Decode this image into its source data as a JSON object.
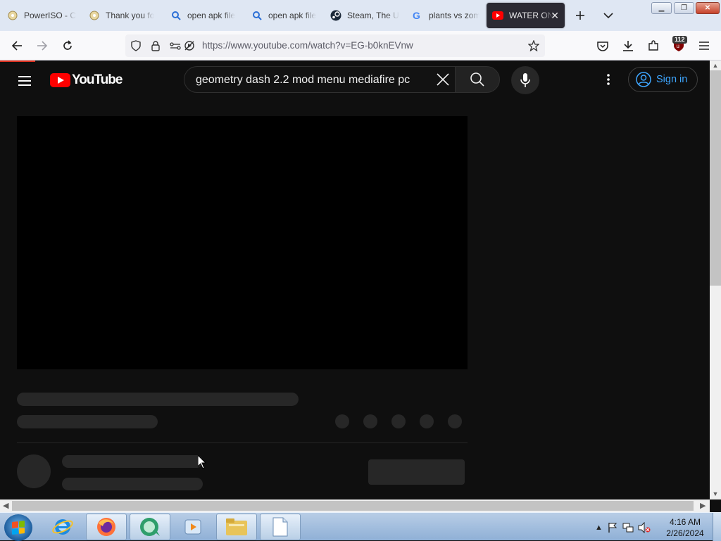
{
  "browser": {
    "tabs": [
      {
        "label": "PowerISO - C",
        "icon": "poweriso-icon"
      },
      {
        "label": "Thank you fo",
        "icon": "poweriso-icon"
      },
      {
        "label": "open apk file",
        "icon": "search-icon"
      },
      {
        "label": "open apk file",
        "icon": "search-icon"
      },
      {
        "label": "Steam, The U",
        "icon": "steam-icon"
      },
      {
        "label": "plants vs zom",
        "icon": "google-icon"
      },
      {
        "label": "WATER ON",
        "icon": "youtube-icon",
        "active": true
      }
    ],
    "url": "https://www.youtube.com/watch?v=EG-b0knEVnw",
    "extension_badge": "112"
  },
  "youtube": {
    "logo_text": "YouTube",
    "search_query": "geometry dash 2.2 mod menu mediafire pc",
    "sign_in_label": "Sign in"
  },
  "taskbar": {
    "time": "4:16 AM",
    "date": "2/26/2024"
  },
  "colors": {
    "yt_bg": "#0f0f0f",
    "yt_red": "#ff0000",
    "link_blue": "#3ea6ff",
    "skeleton": "#272727"
  }
}
